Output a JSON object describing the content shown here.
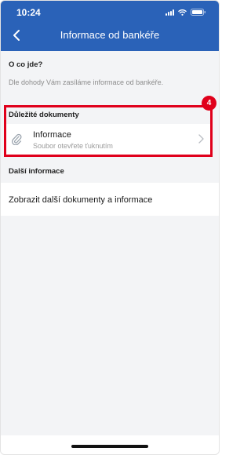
{
  "status_bar": {
    "time": "10:24"
  },
  "nav": {
    "title": "Informace od bankéře"
  },
  "about": {
    "heading": "O co jde?",
    "text": "Dle dohody Vám zasíláme informace od bankéře."
  },
  "documents": {
    "heading": "Důležité dokumenty",
    "items": [
      {
        "title": "Informace",
        "subtitle": "Soubor otevřete ťuknutím",
        "icon": "paperclip-icon"
      }
    ]
  },
  "more": {
    "heading": "Další informace",
    "link_label": "Zobrazit další dokumenty a informace"
  },
  "annotation": {
    "badge": "4",
    "color": "#e0001b"
  },
  "colors": {
    "header": "#2a62b8",
    "background": "#f3f4f6"
  }
}
